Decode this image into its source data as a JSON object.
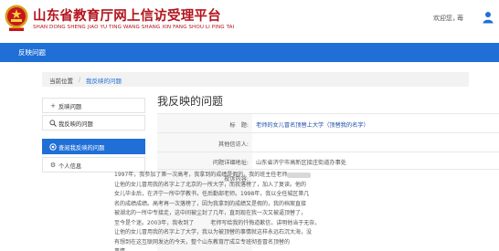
{
  "header": {
    "title": "山东省教育厅网上信访受理平台",
    "subtitle": "SHAN DONG SHENG JIAO YU TING WANG SHANG XIN FANG SHOU LI PING TAI",
    "welcome": "欢迎您，",
    "user_name": "苺",
    "title_color": "#b4141c"
  },
  "navbar": {
    "item": "反映问题",
    "color": "#1f6fd6"
  },
  "breadcrumb": {
    "home": "当前位置",
    "separator": "/",
    "current": "我反映的问题"
  },
  "sidebar": {
    "items": [
      {
        "label": "反映问题",
        "icon": "plus-icon",
        "active": false
      },
      {
        "label": "我反映的问题",
        "icon": "search-icon",
        "active": false
      },
      {
        "label": "查阅我反映的问题",
        "icon": "eye-icon",
        "active": true
      },
      {
        "label": "个人信息",
        "icon": "gear-icon",
        "active": false
      }
    ]
  },
  "content": {
    "title": "我反映的问题",
    "fields": [
      {
        "label": "标　题:",
        "value": "老师的女儿冒名顶替上大学（顶替我的名字）"
      },
      {
        "label": "其他信访人:",
        "value": ""
      },
      {
        "label": "问题详细地址:",
        "value": "山东省济宁市高新区接庄街道办事处"
      },
      {
        "label": "投诉内容:",
        "value": ""
      }
    ],
    "description_lines": [
      "1997年，我参加了第一次高考，我拿到的成绩是假的，我的班主任老师",
      "让他的女儿冒用我的名字上了北京的一所大学，而我落榜了，加入了复读。他的",
      "女儿毕业后，在济宁一所中学教书，任后勤部老师。1998年，我以全任城区第几",
      "名的成绩成绩。高考再一次落榜了，因为我拿到的成绩又是假的，我的档案直接",
      "被湖北的一所中专接走，这中间被尘封了几年，直到现在我一次又被逼顶替了，",
      "至今是个迷。2003年，我收到了　　　老师写给我的忏悔道歉信，讲明他当于无奈，",
      "让他的女儿冒用我的名字上了大学，我以为被顶替的事情就这样永远石沉大海，没",
      "有想到在这互联网发达的今天，整个山东教育厅成立专班彻查冒名顶替的",
      "事情"
    ]
  }
}
